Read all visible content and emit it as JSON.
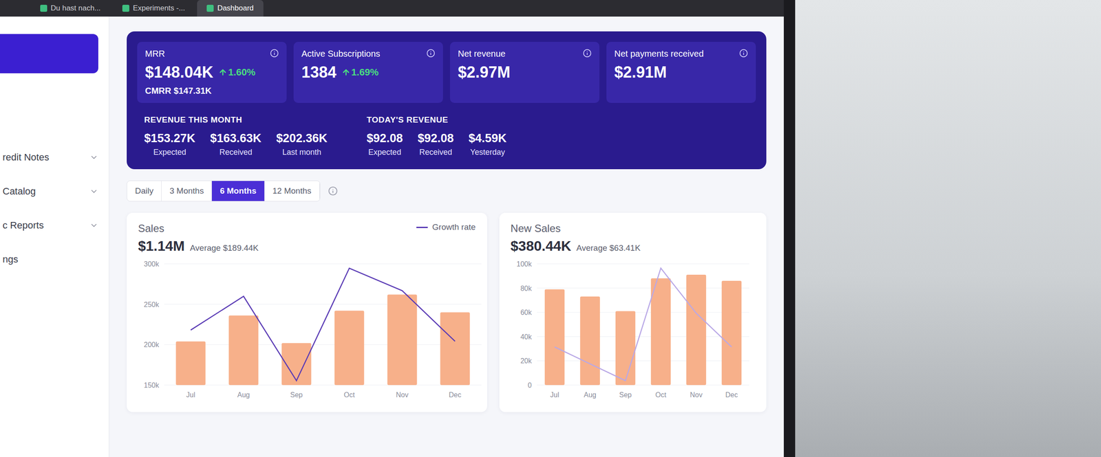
{
  "browser_tabs": [
    {
      "label": "Du hast nach...",
      "selected": false
    },
    {
      "label": "Experiments -...",
      "selected": false
    },
    {
      "label": "Dashboard",
      "selected": true
    }
  ],
  "sidebar": {
    "items": [
      {
        "label": "redit Notes",
        "chevron": true
      },
      {
        "label": "Catalog",
        "chevron": true
      },
      {
        "label": "c Reports",
        "chevron": true
      },
      {
        "label": "ngs",
        "chevron": false
      }
    ]
  },
  "stats": [
    {
      "title": "MRR",
      "value": "$148.04K",
      "delta": "1.60%",
      "sub": "CMRR $147.31K"
    },
    {
      "title": "Active Subscriptions",
      "value": "1384",
      "delta": "1.69%"
    },
    {
      "title": "Net revenue",
      "value": "$2.97M"
    },
    {
      "title": "Net payments received",
      "value": "$2.91M"
    }
  ],
  "revenue_groups": [
    {
      "title": "REVENUE THIS MONTH",
      "items": [
        {
          "value": "$153.27K",
          "label": "Expected"
        },
        {
          "value": "$163.63K",
          "label": "Received"
        },
        {
          "value": "$202.36K",
          "label": "Last month"
        }
      ]
    },
    {
      "title": "TODAY'S REVENUE",
      "items": [
        {
          "value": "$92.08",
          "label": "Expected"
        },
        {
          "value": "$92.08",
          "label": "Received"
        },
        {
          "value": "$4.59K",
          "label": "Yesterday"
        }
      ]
    }
  ],
  "range_tabs": [
    {
      "label": "Daily",
      "selected": false
    },
    {
      "label": "3 Months",
      "selected": false
    },
    {
      "label": "6 Months",
      "selected": true
    },
    {
      "label": "12 Months",
      "selected": false
    }
  ],
  "charts": [
    {
      "title": "Sales",
      "total": "$1.14M",
      "average": "Average $189.44K",
      "legend": "Growth rate",
      "ticks": [
        "300k",
        "250k",
        "200k",
        "150k"
      ],
      "labels": [
        "Jul",
        "Aug",
        "Sep",
        "Oct",
        "Nov",
        "Dec"
      ],
      "bars": [
        204,
        236,
        202,
        242,
        262,
        240
      ],
      "line": [
        6,
        18,
        -12,
        28,
        20,
        2
      ]
    },
    {
      "title": "New Sales",
      "total": "$380.44K",
      "average": "Average $63.41K",
      "ticks": [
        "100k",
        "80k",
        "60k",
        "40k",
        "20k",
        "0"
      ],
      "labels": [
        "Jul",
        "Aug",
        "Sep",
        "Oct",
        "Nov",
        "Dec"
      ],
      "bars": [
        79,
        73,
        61,
        88,
        91,
        86
      ],
      "line": [
        14,
        8,
        2,
        42,
        26,
        14
      ]
    }
  ]
}
